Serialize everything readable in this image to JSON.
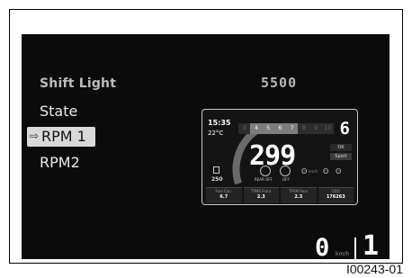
{
  "menu": {
    "title": "Shift Light",
    "value": "5500",
    "items": [
      {
        "label": "State",
        "selected": false
      },
      {
        "label": "RPM 1",
        "selected": true
      },
      {
        "label": "RPM2",
        "selected": false
      }
    ]
  },
  "preview": {
    "time": "15:35",
    "temperature": "22°C",
    "rpm_scale": [
      "3",
      "4",
      "5",
      "6",
      "7",
      "8",
      "9",
      "10"
    ],
    "gear": "6",
    "speed": "299",
    "unit": "km/h",
    "ok_label": "OK",
    "mode": "Sport",
    "fuel_range": "250",
    "icons": [
      {
        "name": "rear-off",
        "label": "REAR OFF"
      },
      {
        "name": "abs-off",
        "label": "OFF"
      }
    ],
    "bottom": [
      {
        "label": "Fuel Con.",
        "value": "6.7"
      },
      {
        "label": "TPMS Front",
        "value": "2.3"
      },
      {
        "label": "TPSM Rear",
        "value": "2.3"
      },
      {
        "label": "ODO",
        "value": "176263"
      }
    ]
  },
  "bottom_bar": {
    "speed": "0",
    "unit": "km/h",
    "gear": "1"
  },
  "reference": "I00243-01"
}
